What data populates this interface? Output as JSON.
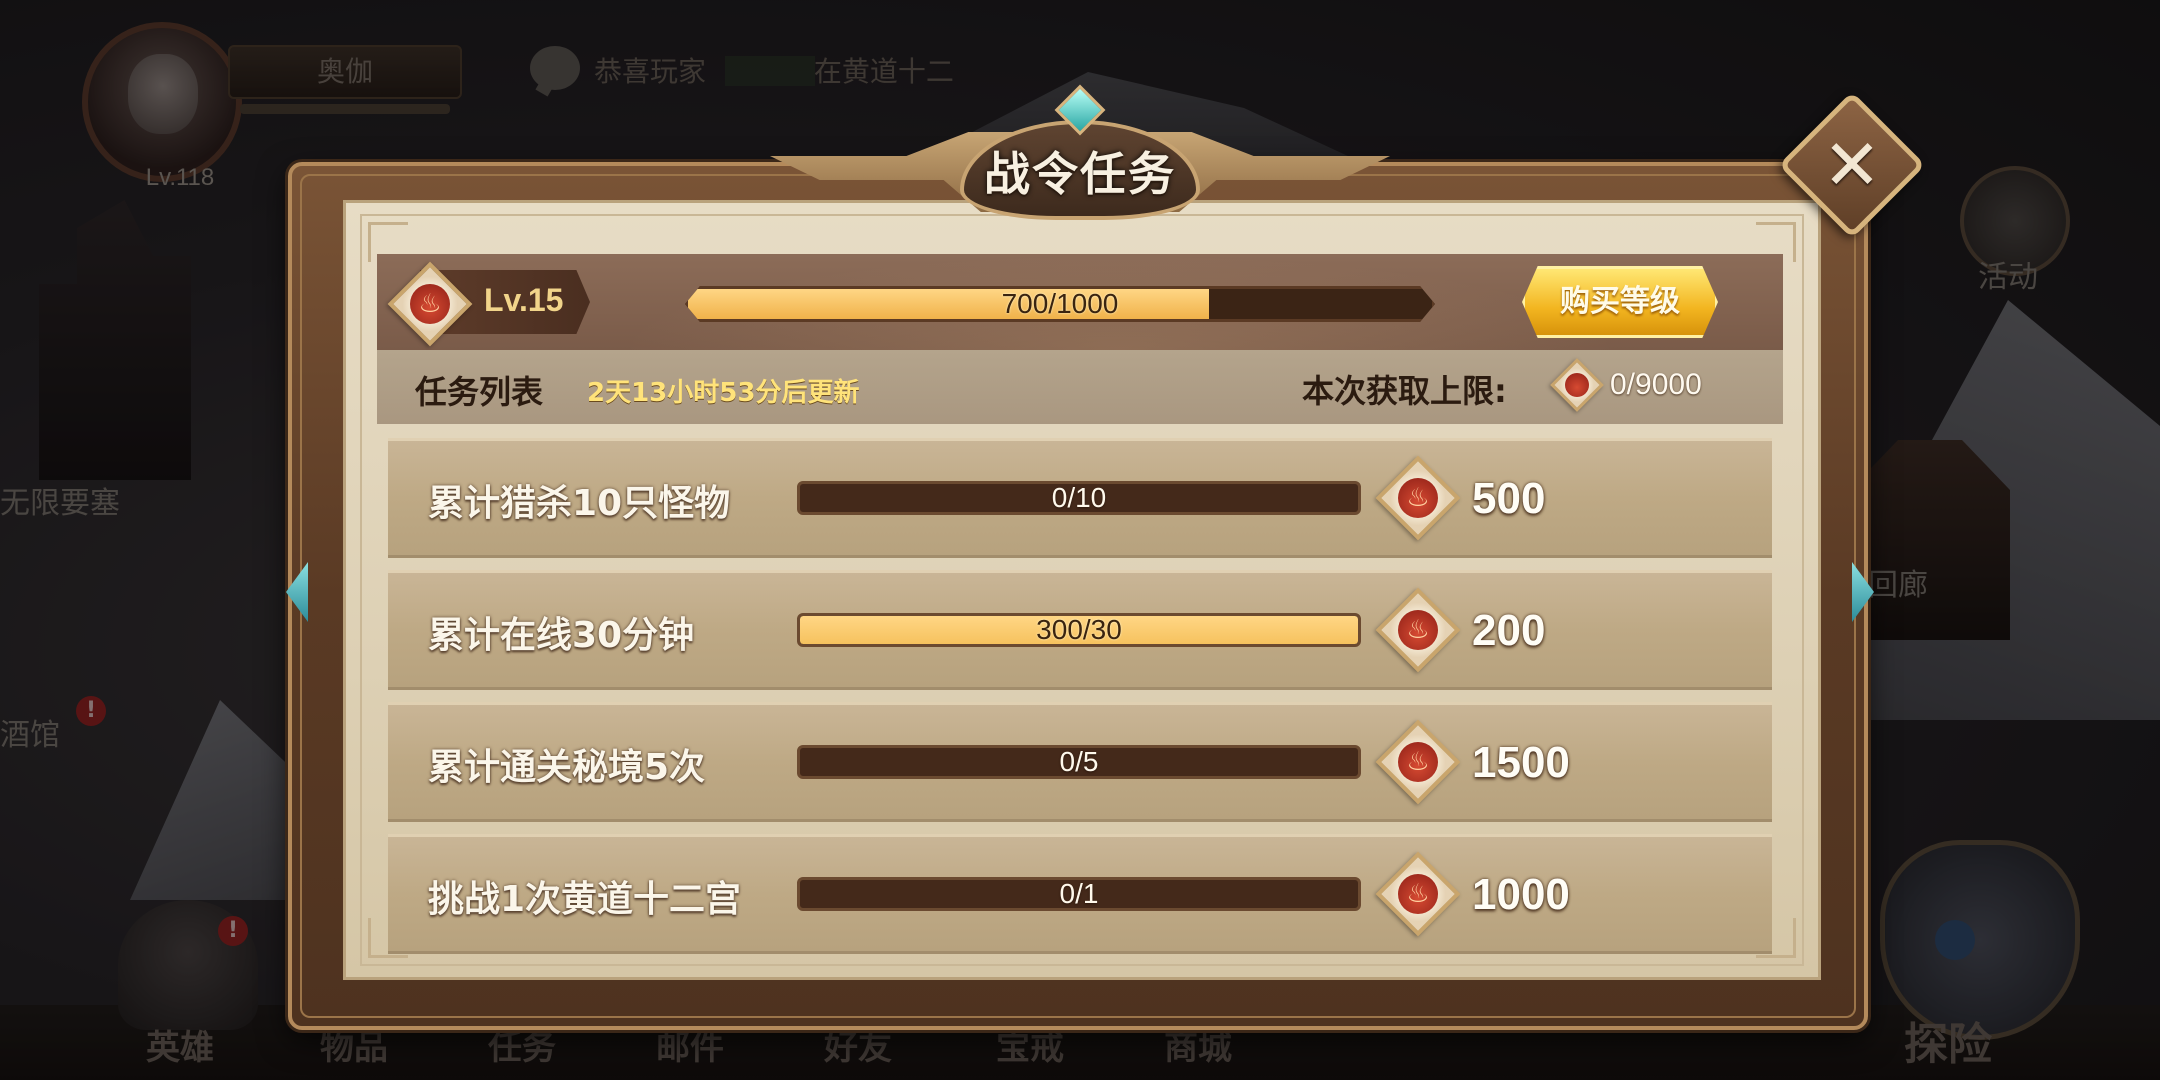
{
  "background": {
    "player": {
      "name": "奥伽",
      "level": "Lv.118"
    },
    "news": {
      "prefix": "恭喜玩家",
      "suffix": "在黄道十二"
    },
    "side_labels": {
      "fortress": "无限要塞",
      "tavern": "酒馆",
      "activity": "活动",
      "corridor": "回廊"
    },
    "badge": "!",
    "bottom_nav": [
      "英雄",
      "物品",
      "任务",
      "邮件",
      "好友",
      "宝戒",
      "商城",
      "探险"
    ]
  },
  "popup": {
    "title": "战令任务",
    "close_icon": "close-icon",
    "level": {
      "label": "Lv.15",
      "exp_text": "700/1000",
      "exp_fraction": 0.7
    },
    "buy_button": "购买等级",
    "task_list_title": "任务列表",
    "refresh_text": "2天13小时53分后更新",
    "limit_label": "本次获取上限:",
    "limit_value": "0/9000",
    "tasks": [
      {
        "name": "累计猎杀10只怪物",
        "progress_text": "0/10",
        "fraction": 0.0,
        "reward": "500"
      },
      {
        "name": "累计在线30分钟",
        "progress_text": "300/30",
        "fraction": 1.0,
        "reward": "200"
      },
      {
        "name": "累计通关秘境5次",
        "progress_text": "0/5",
        "fraction": 0.0,
        "reward": "1500"
      },
      {
        "name": "挑战1次黄道十二宫",
        "progress_text": "0/1",
        "fraction": 0.0,
        "reward": "1000"
      }
    ]
  },
  "colors": {
    "progress_fill": "#f6c25e",
    "buy_button": "#f2b520",
    "refresh_text": "#ffe37a"
  }
}
